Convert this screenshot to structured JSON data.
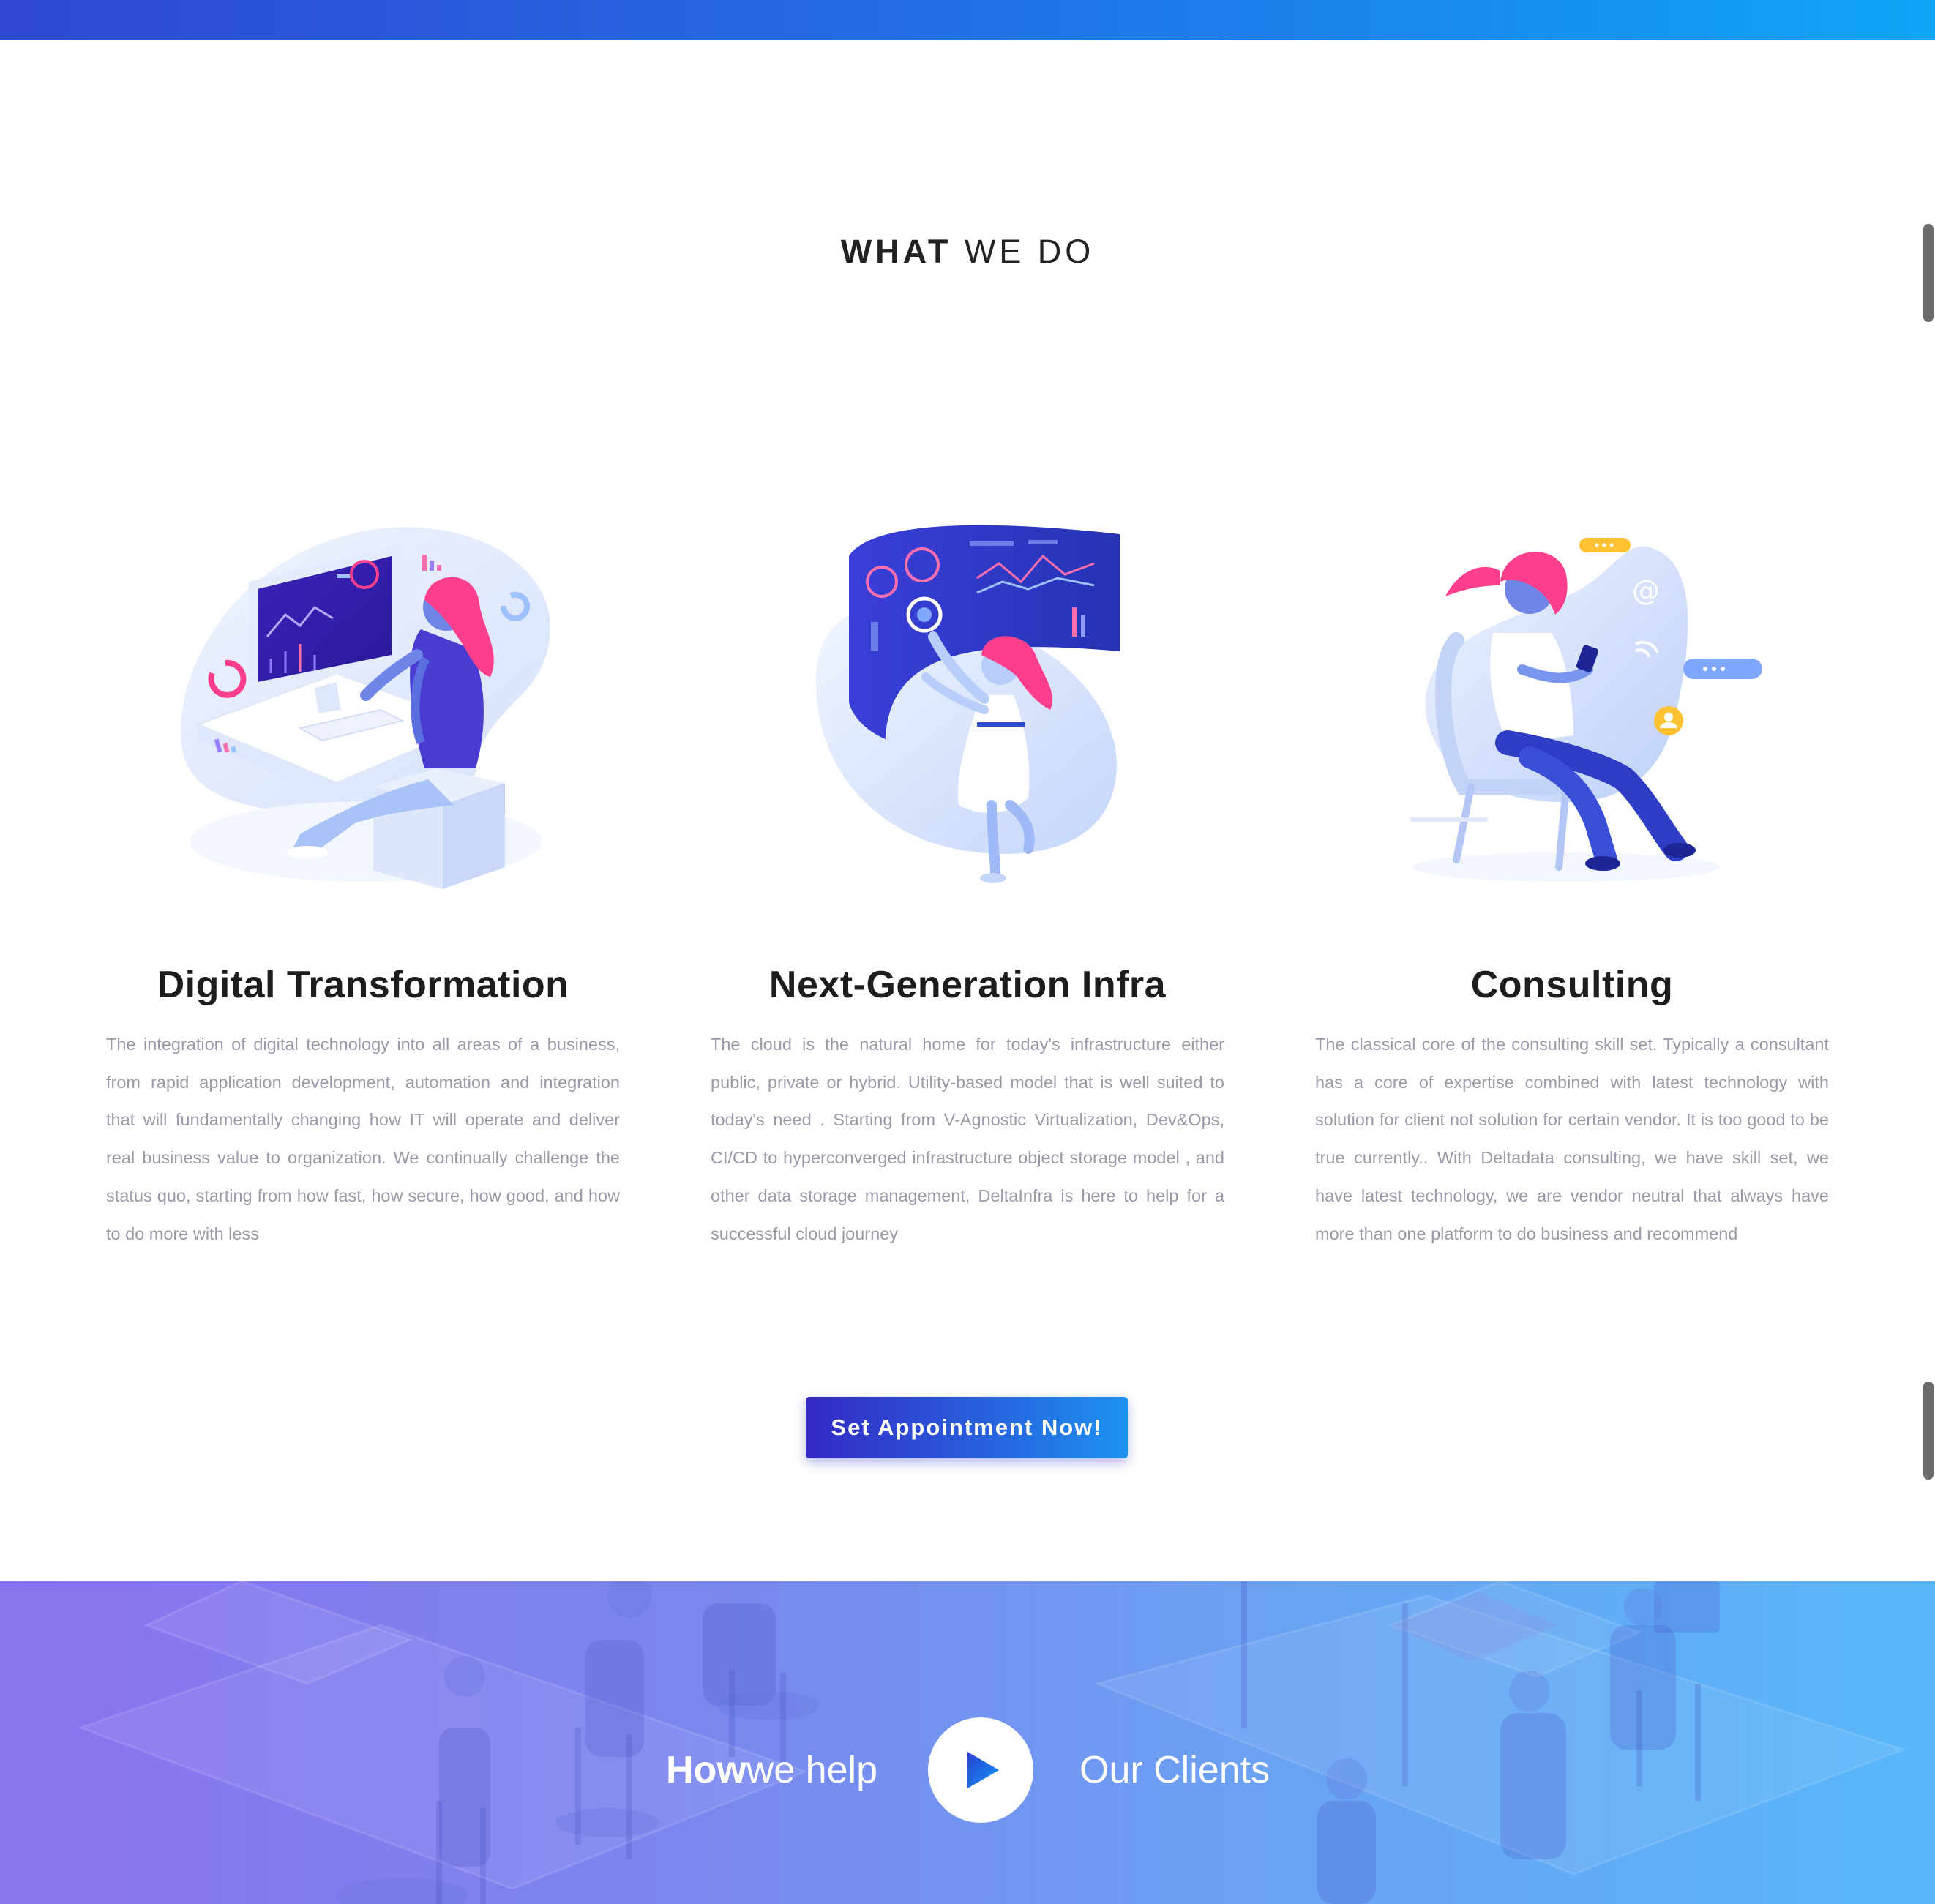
{
  "header": {
    "title_bold": "WHAT",
    "title_rest": " WE DO"
  },
  "services": [
    {
      "title": "Digital Transformation",
      "description": "The integration of digital technology into all areas of a business, from rapid application development, automation and integration that will fundamentally changing how IT will operate and deliver real business value to organization. We continually challenge the status quo,  starting from how fast, how secure, how good, and how to do more with less"
    },
    {
      "title": "Next-Generation Infra",
      "description": "The cloud is the natural home for today's infrastructure either public, private or hybrid.  Utility-based model that is well suited to today's need . Starting from V-Agnostic Virtualization, Dev&Ops, CI/CD to hyperconverged infrastructure object storage model , and other data storage management, DeltaInfra is here to help for a successful cloud journey"
    },
    {
      "title": "Consulting",
      "description": "The classical core of the consulting skill set. Typically a consultant has a core of expertise combined with latest technology with solution for client not solution for certain vendor. It is too good to be true currently.. With Deltadata consulting, we have skill set, we have latest technology, we are vendor neutral that always have more than one platform to do business and recommend"
    }
  ],
  "cta": {
    "label": "Set Appointment Now!"
  },
  "video_band": {
    "left_label_bold": "How",
    "left_label_rest": "we help",
    "right_label": "Our Clients"
  },
  "colors": {
    "accent_blue": "#2860dc",
    "accent_pink": "#ff3f8e",
    "text_muted": "#9a9aa9"
  },
  "icons": [
    "play-icon"
  ]
}
